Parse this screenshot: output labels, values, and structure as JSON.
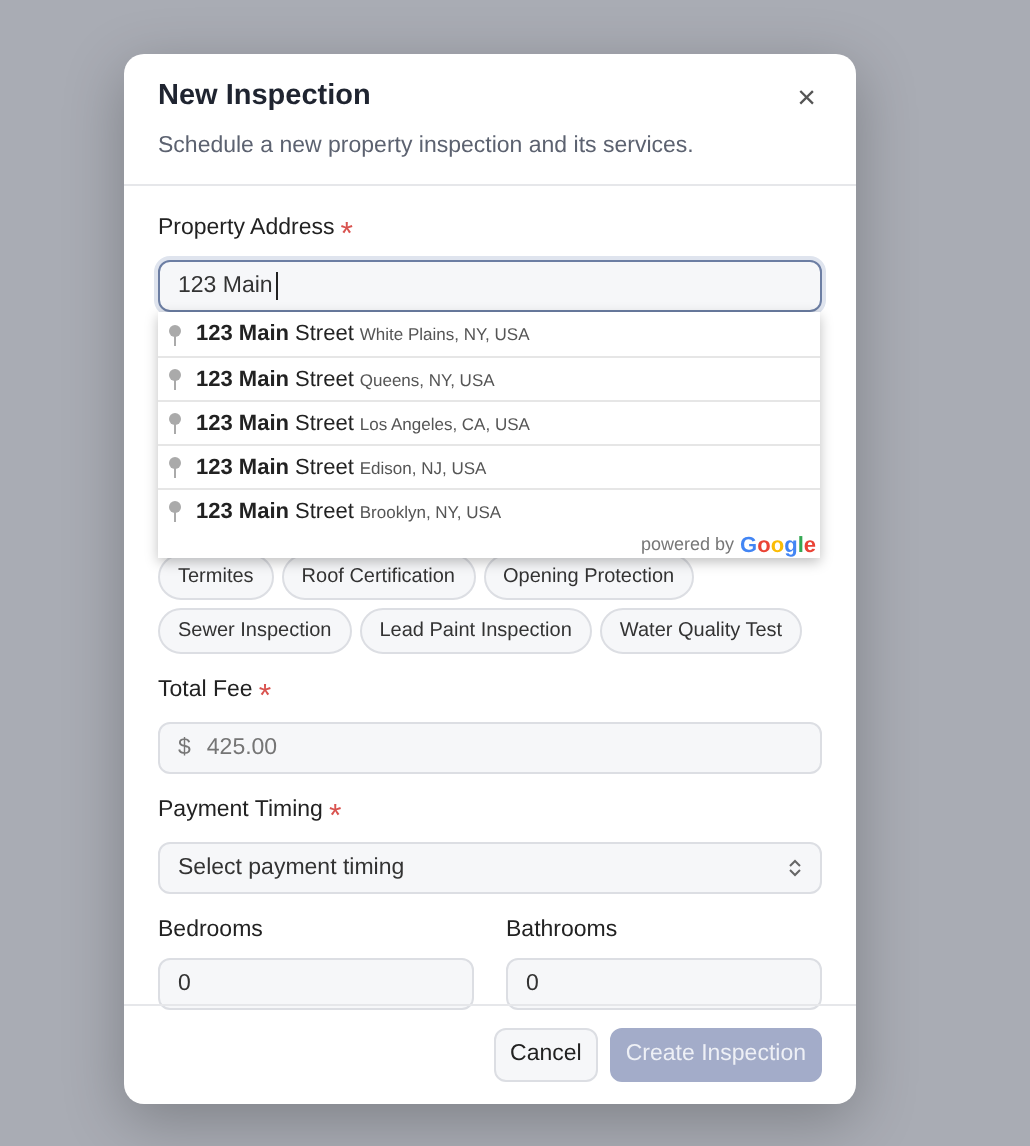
{
  "dialog": {
    "title": "New Inspection",
    "subtitle": "Schedule a new property inspection and its services.",
    "close": "×"
  },
  "address": {
    "label": "Property Address",
    "required_mark": "*",
    "value": "123 Main"
  },
  "suggestions": [
    {
      "main": "**123 Main** Street",
      "secondary": "White Plains, NY, USA"
    },
    {
      "main": "**123 Main** Street",
      "secondary": "Queens, NY, USA"
    },
    {
      "main": "**123 Main** Street",
      "secondary": "Los Angeles, CA, USA"
    },
    {
      "main": "**123 Main** Street",
      "secondary": "Edison, NJ, USA"
    },
    {
      "main": "**123 Main** Street",
      "secondary": "Brooklyn, NY, USA"
    }
  ],
  "attribution": {
    "text": "powered by",
    "logo": "Google"
  },
  "services": [
    [
      "Termites",
      "Roof Certification",
      "Opening Protection"
    ],
    [
      "Sewer Inspection",
      "Lead Paint Inspection",
      "Water Quality Test"
    ]
  ],
  "fee": {
    "label": "Total Fee",
    "required_mark": "*",
    "prefix": "$",
    "placeholder": "425.00"
  },
  "payment": {
    "label": "Payment Timing",
    "required_mark": "*",
    "placeholder": "Select payment timing"
  },
  "rooms": [
    {
      "label": "Bedrooms",
      "value": "0"
    },
    {
      "label": "Bathrooms",
      "value": "0"
    }
  ],
  "buttons": [
    {
      "label": "Cancel",
      "kind": "secondary",
      "disabled": false
    },
    {
      "label": "Create Inspection",
      "kind": "primary",
      "disabled": true
    }
  ]
}
